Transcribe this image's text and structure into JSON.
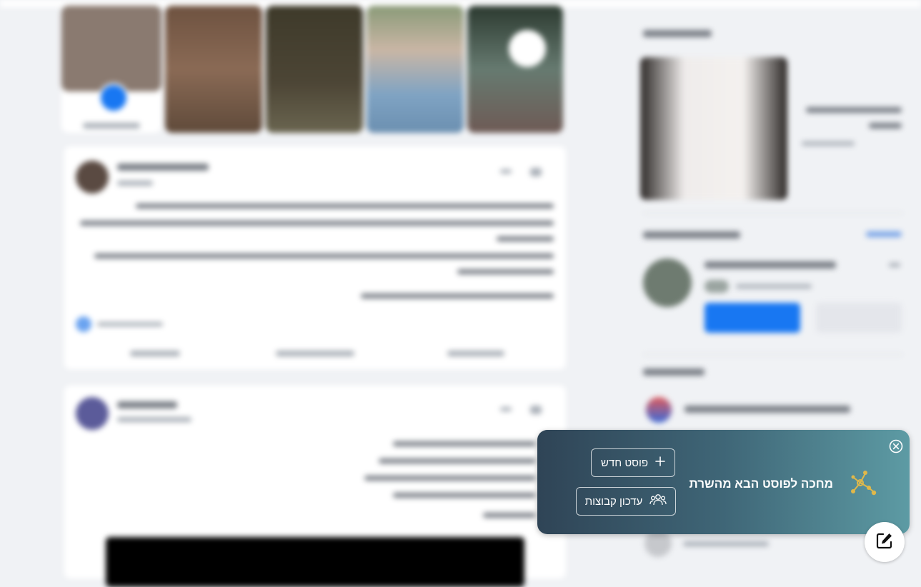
{
  "popup": {
    "title": "מחכה לפוסט הבא מהשרת",
    "new_post_label": "פוסט חדש",
    "update_groups_label": "עדכון קבוצות",
    "icons": {
      "close": "close-circle-icon",
      "molecule": "molecule-icon",
      "plus": "plus-icon",
      "groups": "groups-icon"
    }
  },
  "fab": {
    "icon": "edit-icon"
  },
  "colors": {
    "popup_gradient_start": "#2f4456",
    "popup_gradient_end": "#5d9ba4",
    "molecule_gold": "#e0b84a",
    "page_background": "#f0f2f5"
  }
}
